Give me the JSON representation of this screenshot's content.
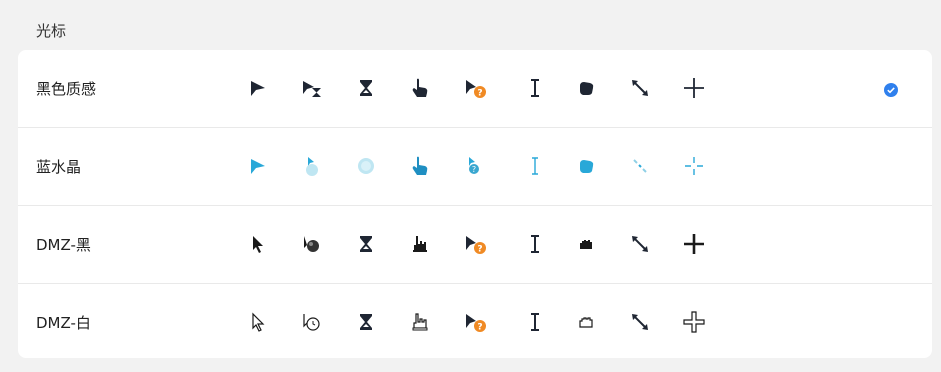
{
  "header": {
    "title": "光标"
  },
  "themes": [
    {
      "label": "黑色质感",
      "selected": true
    },
    {
      "label": "蓝水晶",
      "selected": false
    },
    {
      "label": "DMZ-黑",
      "selected": false
    },
    {
      "label": "DMZ-白",
      "selected": false
    }
  ],
  "colors": {
    "background": "#f2f2f2",
    "card": "#ffffff",
    "divider": "#e9e9e9",
    "check": "#2f80ed",
    "help_badge": "#f08a24",
    "crystal_blue": "#29a8d8"
  },
  "cursor_types": [
    "arrow",
    "busy-arrow",
    "hourglass",
    "hand",
    "help",
    "text-beam",
    "grab",
    "resize-diagonal",
    "crosshair"
  ]
}
